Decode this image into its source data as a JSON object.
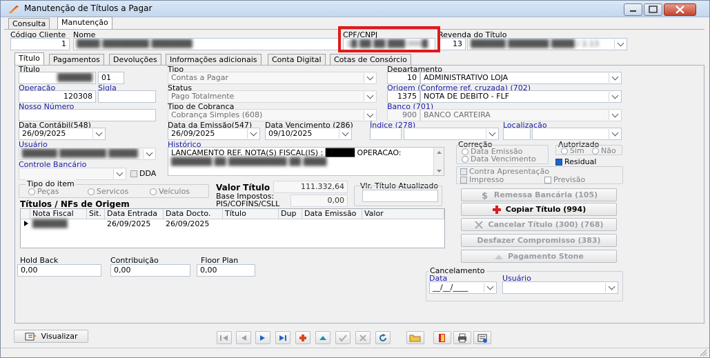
{
  "window": {
    "title": "Manutenção de Títulos a Pagar"
  },
  "main_tabs": [
    "Consulta",
    "Manutenção"
  ],
  "header": {
    "codigo_cliente_label": "Código Cliente",
    "codigo_cliente_value": "1",
    "nome_label": "Nome",
    "nome_value": "████ ████████ ███████",
    "cpf_label": "CPF/CNPJ",
    "cpf_value": "1█ ██ ██ ███ 000█",
    "revenda_label": "Revenda do Título",
    "revenda_code": "13",
    "revenda_value": "██████ ███████ ████ / 2.13"
  },
  "sub_tabs": [
    "Título",
    "Pagamentos",
    "Devoluções",
    "Informações adicionais",
    "Conta Digital",
    "Cotas de Consórcio"
  ],
  "titulo": {
    "titulo_label": "Título",
    "titulo_num": "██████",
    "titulo_seq": "01",
    "operacao_label": "Operação",
    "operacao_value": "120308",
    "sigla_label": "Sigla",
    "nosso_numero_label": "Nosso Número",
    "data_contabil_label": "Data Contábil(548)",
    "data_contabil_value": "26/09/2025",
    "usuario_label": "Usuário",
    "usuario_value": "██████ ████████ █████",
    "controle_bancario_label": "Controle Bancário",
    "dda_label": "DDA"
  },
  "mid": {
    "tipo_label": "Tipo",
    "tipo_value": "Contas a Pagar",
    "status_label": "Status",
    "status_value": "Pago Totalmente",
    "tipo_cobranca_label": "Tipo de Cobrança",
    "tipo_cobranca_value": "Cobrança Simples (608)",
    "data_emissao_label": "Data da Emissão(547)",
    "data_emissao_value": "26/09/2025",
    "data_vencimento_label": "Data Vencimento (286)",
    "data_vencimento_value": "09/10/2025",
    "historico_label": "Histórico",
    "historico_line1": "LANCAMENTO REF. NOTA(S) FISCAL(IS) : █████ OPERACAO:",
    "historico_line2": "███████ ██ ██████████ ██ ████"
  },
  "right": {
    "departamento_label": "Departamento",
    "departamento_code": "10",
    "departamento_value": "ADMINISTRATIVO LOJA",
    "origem_label": "Origem (Conforme ref. cruzada) (702)",
    "origem_code": "1375",
    "origem_value": "NOTA DE DEBITO - FLF",
    "banco_label": "Banco (701)",
    "banco_code": "900",
    "banco_value": "BANCO CARTEIRA",
    "indice_label": "Índice (278)",
    "localizacao_label": "Localização"
  },
  "correcao": {
    "label": "Correção",
    "opt1": "Data Emissão",
    "opt2": "Data Vencimento"
  },
  "autorizado": {
    "label": "Autorizado",
    "sim": "Sim",
    "nao": "Não",
    "residual": "Residual"
  },
  "flags": {
    "contra_apresentacao": "Contra Apresentação",
    "impresso": "Impresso",
    "previsao": "Previsão"
  },
  "tipo_item": {
    "label": "Tipo do item",
    "pecas": "Peças",
    "servicos": "Servicos",
    "veiculos": "Veículos"
  },
  "valores": {
    "valor_titulo_label": "Valor Título",
    "valor_titulo_value": "111.332,64",
    "base_impostos_label1": "Base Impostos:",
    "base_impostos_label2": "PIS/COFINS/CSLL",
    "base_impostos_value": "0,00",
    "vlr_atualizado_label": "Vlr. Título Atualizado"
  },
  "nfs": {
    "label": "Títulos / NFs de Origem",
    "columns": [
      "Nota Fiscal",
      "Sit.",
      "Data Entrada",
      "Data Docto.",
      "Título",
      "Dup",
      "Data Emissão",
      "Valor"
    ],
    "row": [
      "██████",
      "",
      "26/09/2025",
      "26/09/2025",
      "",
      "",
      "",
      ""
    ]
  },
  "bottom_fields": {
    "hold_back_label": "Hold Back",
    "hold_back_value": "0,00",
    "contribuicao_label": "Contribuição",
    "contribuicao_value": "0,00",
    "floor_plan_label": "Floor Plan",
    "floor_plan_value": "0,00"
  },
  "actions": {
    "remessa": "Remessa Bancária (105)",
    "copiar": "Copiar Título (994)",
    "cancelar": "Cancelar Título (300) (768)",
    "desfazer": "Desfazer Compromisso (383)",
    "pagamento_stone": "Pagamento Stone"
  },
  "cancelamento": {
    "label": "Cancelamento",
    "data_label": "Data",
    "data_value": "__/__/____",
    "usuario_label": "Usuário"
  },
  "footer": {
    "visualizar": "Visualizar"
  },
  "colors": {
    "highlight": "#e01a1a",
    "blue_label": "#1a1aa6"
  }
}
